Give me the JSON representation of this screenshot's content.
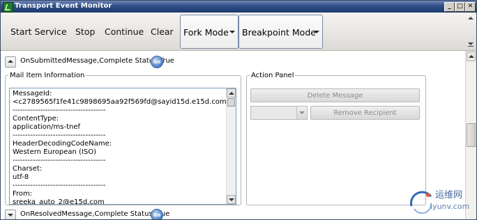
{
  "window": {
    "title": "Transport Event Monitor"
  },
  "titlebar_buttons": {
    "minimize": "_",
    "maximize": "□",
    "close": "✕"
  },
  "toolbar": {
    "start_service": "Start Service",
    "stop": "Stop",
    "continue": "Continue",
    "clear": "Clear",
    "fork_mode": "Fork Mode",
    "breakpoint_mode": "Breakpoint Mode"
  },
  "events": [
    {
      "label": "OnSubmittedMessage,Complete Status:True",
      "go": "Go",
      "expanded": true
    },
    {
      "label": "OnResolvedMessage,Complete Status:True",
      "go": "Go",
      "expanded": false
    }
  ],
  "mail_item": {
    "legend": "Mail Item Information",
    "lines": [
      "MessageId:",
      "<c2789565f1fe41c9898695aa92f569fd@sayid15d.e15d.com>",
      "-------------------------------------",
      "ContentType:",
      "application/ms-tnef",
      "-------------------------------------",
      "HeaderDecodingCodeName:",
      "Western European (ISO)",
      "-------------------------------------",
      "Charset:",
      "utf-8",
      "-------------------------------------",
      "From:",
      "sreeka_auto_2@e15d.com"
    ]
  },
  "action_panel": {
    "legend": "Action Panel",
    "delete_message": "Delete Message",
    "remove_recipient": "Remove Recipient",
    "recipient_select_value": ""
  },
  "watermark": {
    "cn": "运维网",
    "en": "iyunv.com"
  },
  "colors": {
    "titlebar": "#2f4f87",
    "go_button": "#4a7fc6",
    "disabled_text": "#8a8a8a"
  }
}
